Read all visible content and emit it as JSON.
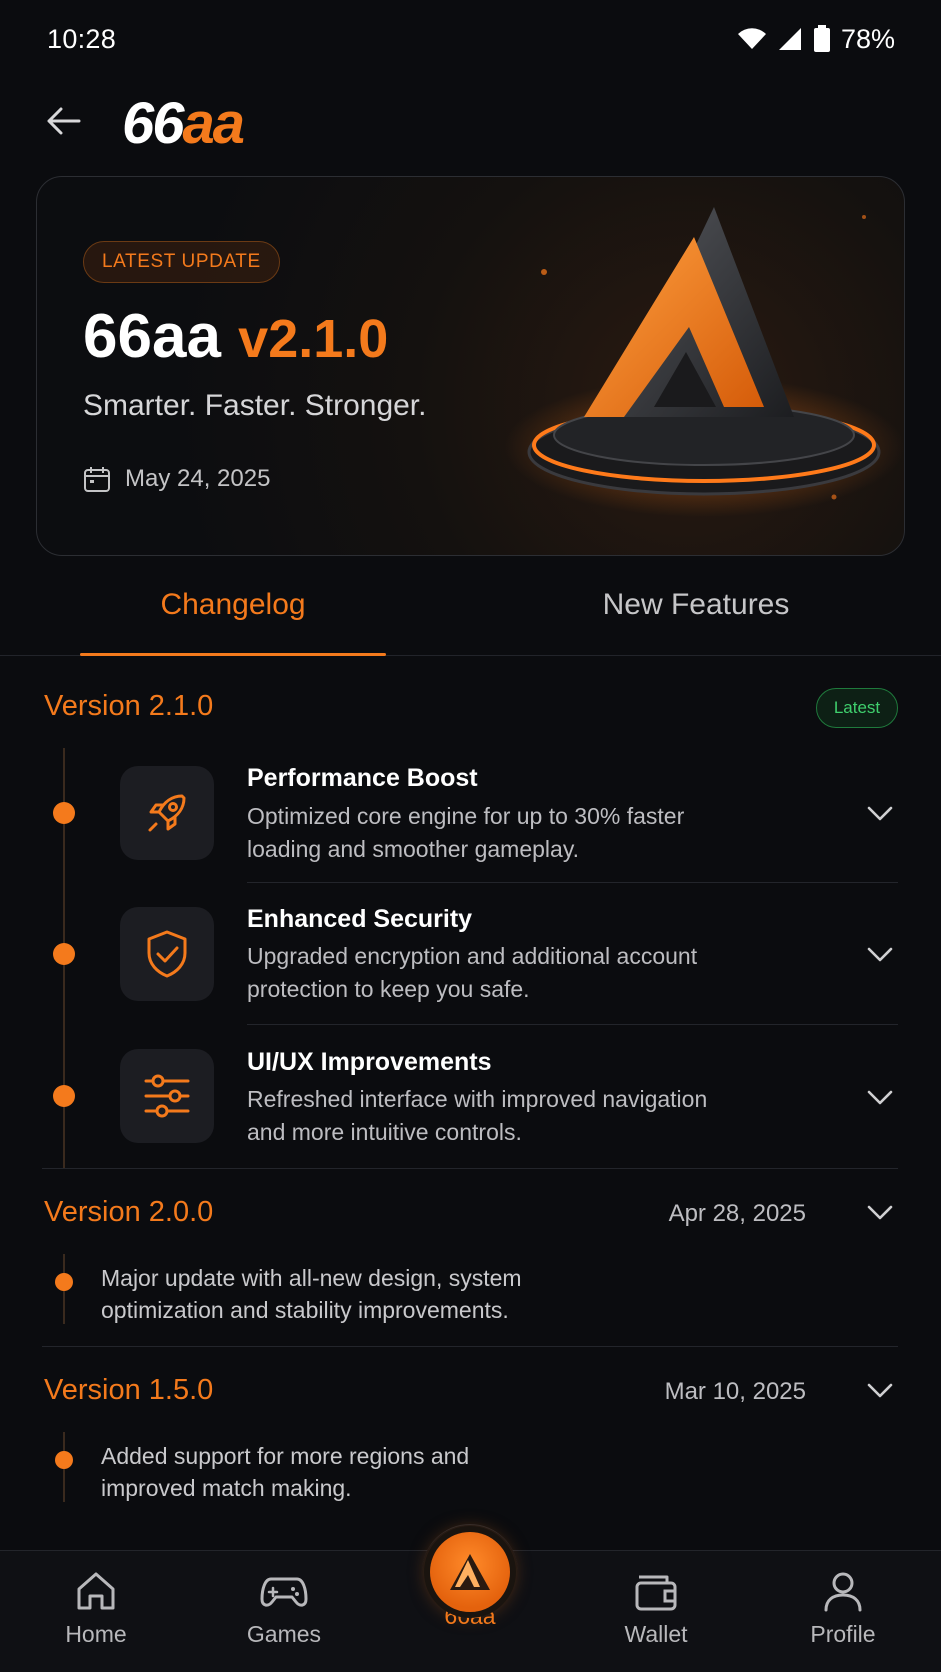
{
  "status": {
    "time": "10:28",
    "battery": "78%"
  },
  "header": {
    "logo_white": "66",
    "logo_orange": "aa"
  },
  "hero": {
    "badge": "LATEST UPDATE",
    "app_name": "66aa",
    "version": "v2.1.0",
    "tagline": "Smarter. Faster. Stronger.",
    "date": "May 24, 2025"
  },
  "tabs": {
    "changelog": "Changelog",
    "new_features": "New Features"
  },
  "changelog": {
    "v210": {
      "title": "Version 2.1.0",
      "badge": "Latest",
      "items": [
        {
          "title": "Performance Boost",
          "line1": "Optimized core engine for up to 30% faster",
          "line2": "loading and smoother gameplay.",
          "icon": "rocket-icon"
        },
        {
          "title": "Enhanced Security",
          "line1": "Upgraded encryption and additional account",
          "line2": "protection to keep you safe.",
          "icon": "shield-check-icon"
        },
        {
          "title": "UI/UX Improvements",
          "line1": "Refreshed interface with improved navigation",
          "line2": "and more intuitive controls.",
          "icon": "sliders-icon"
        }
      ]
    },
    "v200": {
      "title": "Version 2.0.0",
      "date": "Apr 28, 2025",
      "line1": "Major update with all-new design, system",
      "line2": "optimization and stability improvements."
    },
    "v150": {
      "title": "Version 1.5.0",
      "date": "Mar 10, 2025",
      "line1": "Added support for more regions and",
      "line2": "improved match making."
    }
  },
  "nav": {
    "home": "Home",
    "games": "Games",
    "center": "66aa",
    "wallet": "Wallet",
    "profile": "Profile"
  },
  "colors": {
    "accent": "#f47a1c",
    "background": "#0b0c0f",
    "success": "#3fcf6d"
  }
}
